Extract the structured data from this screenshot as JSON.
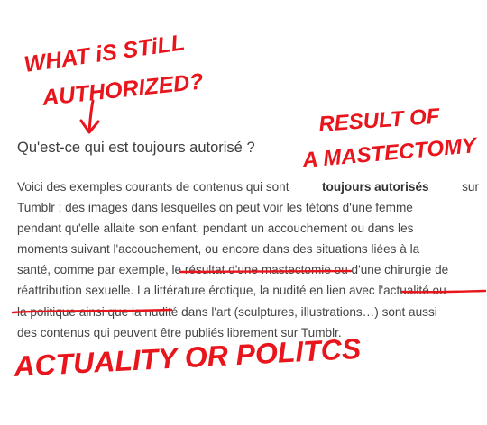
{
  "section": {
    "heading": "Qu'est-ce qui est toujours autorisé ?",
    "lines": [
      [
        "Voici des exemples courants de contenus qui sont ",
        "toujours autorisés",
        " sur"
      ],
      [
        "Tumblr : des images dans lesquelles on peut voir les tétons d'une femme"
      ],
      [
        "pendant qu'elle allaite son enfant, pendant un accouchement ou dans les"
      ],
      [
        "moments suivant l'accouchement, ou encore dans des situations liées à la"
      ],
      [
        "santé, comme par exemple, le résultat d'une mastectomie ou d'une chirurgie de"
      ],
      [
        "réattribution sexuelle. La littérature érotique, la nudité en lien avec l'actualité ou"
      ],
      [
        "la politique ainsi que la nudité dans l'art (sculptures, illustrations…) sont aussi"
      ],
      [
        "des contenus qui peuvent être publiés librement sur Tumblr."
      ]
    ]
  },
  "annotations": {
    "top_left_line1": "WHAT iS STiLL",
    "top_left_line2": "AUTHORIZED?",
    "top_right_line1": "RESULT OF",
    "top_right_line2": "A MASTECTOMY",
    "bottom": "ACTUALITY OR POLITCS",
    "ink_color": "#e8161c"
  }
}
